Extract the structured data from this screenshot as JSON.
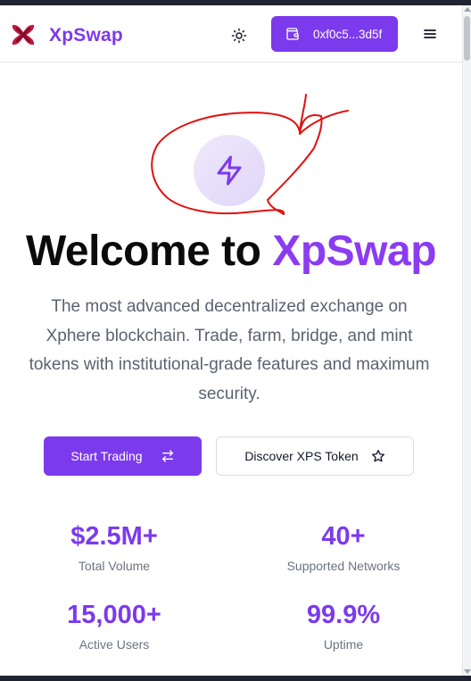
{
  "header": {
    "brand": "XpSwap",
    "wallet_address": "0xf0c5...3d5f",
    "icons": {
      "logo": "xpswap-logo",
      "theme_toggle": "sun-icon",
      "wallet": "wallet-icon",
      "menu": "hamburger-menu-icon"
    }
  },
  "hero": {
    "icon": "lightning-bolt-icon",
    "title_prefix": "Welcome to ",
    "title_accent": "XpSwap",
    "description": "The most advanced decentralized exchange on Xphere blockchain. Trade, farm, bridge, and mint tokens with institutional-grade features and maximum security."
  },
  "actions": {
    "primary_label": "Start Trading",
    "primary_icon": "swap-arrows-icon",
    "secondary_label": "Discover XPS Token",
    "secondary_icon": "star-icon"
  },
  "stats": [
    {
      "value": "$2.5M+",
      "label": "Total Volume"
    },
    {
      "value": "40+",
      "label": "Supported Networks"
    },
    {
      "value": "15,000+",
      "label": "Active Users"
    },
    {
      "value": "99.9%",
      "label": "Uptime"
    }
  ],
  "colors": {
    "accent": "#7c3aed",
    "title_accent": "#8b3cf2",
    "annotation": "#e01010"
  }
}
